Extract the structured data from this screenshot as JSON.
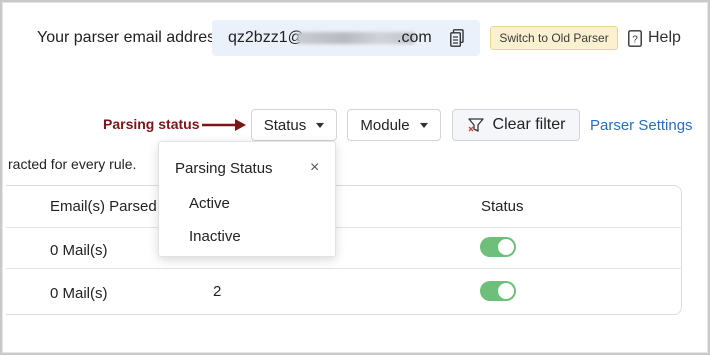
{
  "header": {
    "email_label": "Your parser email address",
    "email_prefix": "qz2bzz1@",
    "email_suffix": ".com",
    "old_parser_button": "Switch to Old Parser",
    "help_label": "Help"
  },
  "toolbar": {
    "annotation": "Parsing status",
    "status_button": "Status",
    "module_button": "Module",
    "clear_filter_button": "Clear filter",
    "parser_settings_link": "Parser Settings"
  },
  "info_text": "racted for every rule.",
  "table": {
    "headers": [
      "Email(s) Parsed",
      "Status"
    ],
    "rows": [
      {
        "emails_parsed": "0 Mail(s)",
        "count": "",
        "status_on": true
      },
      {
        "emails_parsed": "0 Mail(s)",
        "count": "2",
        "status_on": true
      }
    ]
  },
  "dropdown": {
    "title": "Parsing Status",
    "close_icon": "×",
    "options": [
      "Active",
      "Inactive"
    ]
  },
  "colors": {
    "toggle_on": "#6dbf7a",
    "link": "#2a6ebb",
    "annotation": "#7a1618",
    "old_parser_bg": "#fbf0cf"
  }
}
